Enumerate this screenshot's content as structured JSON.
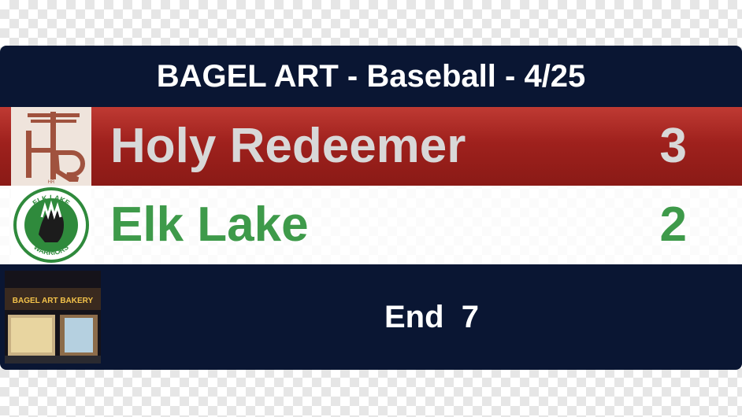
{
  "header": {
    "title": "BAGEL ART - Baseball - 4/25"
  },
  "home": {
    "name": "Holy Redeemer",
    "score": "3",
    "logo_initials": "HR",
    "color": "#9f211d",
    "text_color": "#d8d8d8"
  },
  "away": {
    "name": "Elk Lake",
    "score": "2",
    "logo_top_text": "ELK LAKE",
    "logo_bottom_text": "WARRIORS",
    "color": "#3e9a4a"
  },
  "footer": {
    "status": "End  7",
    "sponsor_sign": "BAGEL ART BAKERY"
  },
  "colors": {
    "navy": "#0a1633"
  }
}
